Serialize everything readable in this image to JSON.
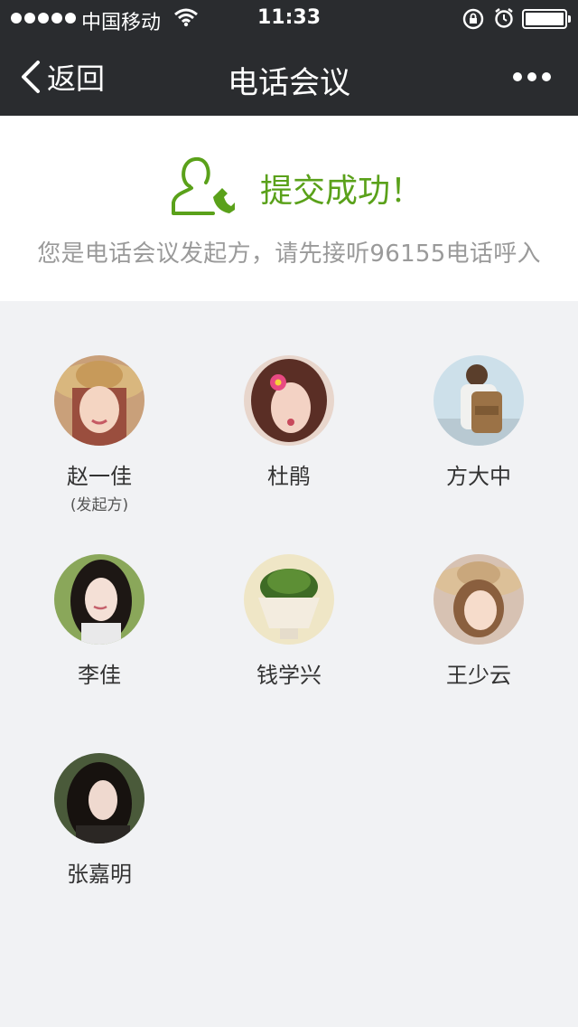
{
  "status_bar": {
    "carrier": "中国移动",
    "time": "11:33"
  },
  "nav": {
    "back_label": "返回",
    "title": "电话会议"
  },
  "notice": {
    "success_text": "提交成功！",
    "hint": "您是电话会议发起方，请先接听96155电话呼入"
  },
  "members": [
    {
      "name": "赵一佳",
      "role": "(发起方)",
      "icon": "avatar-girl-straw-hat"
    },
    {
      "name": "杜鹃",
      "role": "",
      "icon": "avatar-girl-flower"
    },
    {
      "name": "方大中",
      "role": "",
      "icon": "avatar-boy-backpack"
    },
    {
      "name": "李佳",
      "role": "",
      "icon": "avatar-girl-long-hair"
    },
    {
      "name": "钱学兴",
      "role": "",
      "icon": "avatar-potted-plant"
    },
    {
      "name": "王少云",
      "role": "",
      "icon": "avatar-girl-sun-hat"
    },
    {
      "name": "张嘉明",
      "role": "",
      "icon": "avatar-girl-dark-hair"
    }
  ],
  "colors": {
    "bar_bg": "#2a2c2f",
    "accent_green": "#5aa11a",
    "page_bg": "#f1f2f4"
  }
}
